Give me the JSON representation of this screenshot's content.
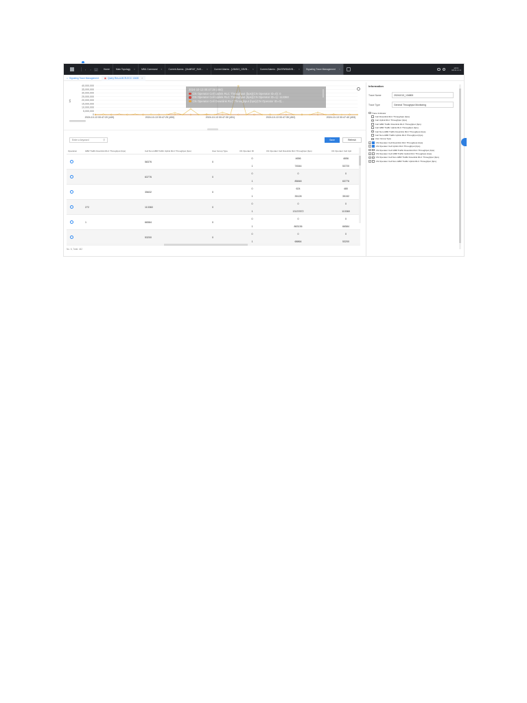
{
  "topbar": {
    "menu_label": "&nbsp;",
    "tabs": [
      {
        "label": "Home",
        "closable": false
      },
      {
        "label": "Main Topology",
        "closable": true
      },
      {
        "label": "MML Command",
        "closable": true
      },
      {
        "label": "Current Alarms - [MultiRAT_SUS...",
        "closable": true
      },
      {
        "label": "Current Alarms - [LNMUX_G8VB...",
        "closable": true
      },
      {
        "label": "Current Alarms - [BUSRW8A8VB...",
        "closable": true
      },
      {
        "label": "Signaling Trace Management",
        "closable": true,
        "active": true
      }
    ],
    "user_line1": "admin",
    "user_line2": "Admin vs vs"
  },
  "breadcrumbs": [
    {
      "label": "Signaling Trace Management",
      "icon": "home-icon"
    },
    {
      "label": "Query Res-A-BCR-ECC 13400",
      "icon": "trace-icon",
      "closable": true
    }
  ],
  "chart_data": {
    "type": "line",
    "y_tick_labels": [
      "40,000,000",
      "35,000,000",
      "30,000,000",
      "25,000,000",
      "20,000,000",
      "15,000,000",
      "10,000,000",
      "5,000,000",
      "0"
    ],
    "ylim": [
      0,
      40000000
    ],
    "ylabel": "b/s",
    "x_tick_labels": [
      "2024-10-13 00:47:20 (449)",
      "2024-10-13 00:47:25 (450)",
      "2024-10-13 00:47:30 (451)",
      "2024-10-13 00:47:35 (452)",
      "2024-10-13 00:47:40 (453)"
    ],
    "series": [
      {
        "name": "CN Operator Cell Uplink RLC Throughput (bps)(CN Operator ID=0)",
        "color": "#d5433a",
        "values": [
          0,
          0,
          0,
          0,
          0,
          0,
          0,
          0,
          0,
          0,
          0,
          0,
          0,
          0,
          0,
          0,
          0,
          0,
          0,
          0,
          0,
          0,
          0,
          0,
          0,
          0,
          0,
          0,
          0,
          0,
          0,
          0,
          0,
          0
        ]
      },
      {
        "name": "CN Operator Cell Uplink RLC Throughput (bps)(CN Operator ID=1)",
        "color": "#e8c05a",
        "values": [
          0,
          400000,
          0,
          600000,
          0,
          500000,
          0,
          300000,
          0,
          200000,
          2500000,
          0,
          8000000,
          0,
          500000,
          0,
          3000000,
          0,
          40000000,
          0,
          5000000,
          0,
          300000,
          0,
          4000000,
          0,
          200000,
          0,
          3000000,
          0,
          500000,
          0,
          200000,
          0
        ]
      },
      {
        "name": "CN Operator Cell Downlink RLC Throughput (bps)(CN Operator ID=0)",
        "color": "#d99a2b",
        "values": [
          0,
          0,
          0,
          0,
          0,
          0,
          0,
          0,
          0,
          0,
          0,
          0,
          0,
          0,
          0,
          0,
          0,
          0,
          0,
          0,
          0,
          0,
          0,
          0,
          0,
          0,
          0,
          0,
          0,
          0,
          0,
          0,
          0,
          0
        ]
      }
    ],
    "tooltip": {
      "title": "2024-10-13 00:47:28 (450)",
      "rows": [
        {
          "text": "CN Operator Cell Uplink RLC Throughput (bps)(CN Operator ID=0): 0",
          "color": "#d5433a"
        },
        {
          "text": "CN Operator Cell Uplink RLC Throughput (bps)(CN Operator ID=1): 113360",
          "color": "#d5433a"
        },
        {
          "text": "CN Operator Cell Downlink RLC Throughput (bps)(CN Operator ID=0)...",
          "color": "#e8a43a"
        }
      ]
    }
  },
  "toolbar": {
    "search_placeholder": "Enter a keyword",
    "save_label": "Save",
    "refresh_label": "Refresh"
  },
  "table": {
    "headers": [
      "Operation",
      "GBR Traffic Downlink RLC Throughput (bps)",
      "Cell Non-GBR Traffic Uplink RLC Throughput (bps)",
      "User Group Type",
      "CN Operator ID",
      "CN Operator Cell Downlink RLC Throughput (bps)",
      "CN Operator Cell Upli"
    ],
    "rows": [
      {
        "gbr": "",
        "nongbr": "58376",
        "ugt": "0",
        "ids": [
          "0",
          "1"
        ],
        "dl": [
          "4656",
          "74544"
        ],
        "ul": [
          "4656",
          "53720"
        ]
      },
      {
        "gbr": "",
        "nongbr": "63776",
        "ugt": "0",
        "ids": [
          "0",
          "1"
        ],
        "dl": [
          "0",
          "85848"
        ],
        "ul": [
          "0",
          "63776"
        ]
      },
      {
        "gbr": "",
        "nongbr": "35632",
        "ugt": "0",
        "ids": [
          "0",
          "1"
        ],
        "dl": [
          "624",
          "35128"
        ],
        "ul": [
          "480",
          "35152"
        ]
      },
      {
        "gbr": "272",
        "nongbr": "113360",
        "ugt": "0",
        "ids": [
          "0",
          "1"
        ],
        "dl": [
          "0",
          "13137872"
        ],
        "ul": [
          "0",
          "113360"
        ]
      },
      {
        "gbr": "1",
        "nongbr": "66584",
        "ugt": "0",
        "ids": [
          "0",
          "1"
        ],
        "dl": [
          "0",
          "863136"
        ],
        "ul": [
          "0",
          "66584"
        ]
      },
      {
        "gbr": "",
        "nongbr": "53200",
        "ugt": "0",
        "ids": [
          "0",
          "1"
        ],
        "dl": [
          "0",
          "68864"
        ],
        "ul": [
          "0",
          "53200"
        ]
      }
    ],
    "footer": "No. 6, Total: 442"
  },
  "info_panel": {
    "title": "Information",
    "trace_name_label": "Trace Name",
    "trace_name_value": "20241013_134800",
    "trace_type_label": "Trace Type",
    "trace_type_value": "General Throughput Monitoring",
    "tree_root": "Trace Indicator",
    "indicators": [
      {
        "label": "Cell Downlink RLC Throughput (bps)",
        "checked": false
      },
      {
        "label": "Cell Uplink RLC Throughput (bps)",
        "checked": false
      },
      {
        "label": "Cell GBR Traffic Downlink RLC Throughput (bps)",
        "checked": false
      },
      {
        "label": "Cell GBR Traffic Uplink RLC Throughput (bps)",
        "checked": false
      },
      {
        "label": "Cell Non-GBR Traffic Downlink RLC Throughput (bps)",
        "checked": false
      },
      {
        "label": "Cell Non-GBR Traffic Uplink RLC Throughput (bps)",
        "checked": false
      },
      {
        "label": "User Group Type",
        "checked": false
      },
      {
        "label": "CN Operator Cell Downlink RLC Throughput (bps)",
        "checked": true,
        "expandable": true
      },
      {
        "label": "CN Operator Cell Uplink RLC Throughput (bps)",
        "checked": true,
        "expandable": true
      },
      {
        "label": "CN Operator Cell GBR Traffic Downlink RLC Throughput (bps)",
        "checked": false,
        "expandable": true
      },
      {
        "label": "CN Operator Cell GBR Traffic Uplink RLC Throughput (bps)",
        "checked": false,
        "expandable": true
      },
      {
        "label": "CN Operator Cell Non-GBR Traffic Downlink RLC Throughput (bps)",
        "checked": false,
        "expandable": true
      },
      {
        "label": "CN Operator Cell Non-GBR Traffic Uplink RLC Throughput (bps)",
        "checked": false,
        "expandable": true
      }
    ]
  },
  "colors": {
    "accent": "#2e7fe0",
    "topbar_bg": "#1f2126",
    "series_uplink_id1": "#e8c05a"
  }
}
